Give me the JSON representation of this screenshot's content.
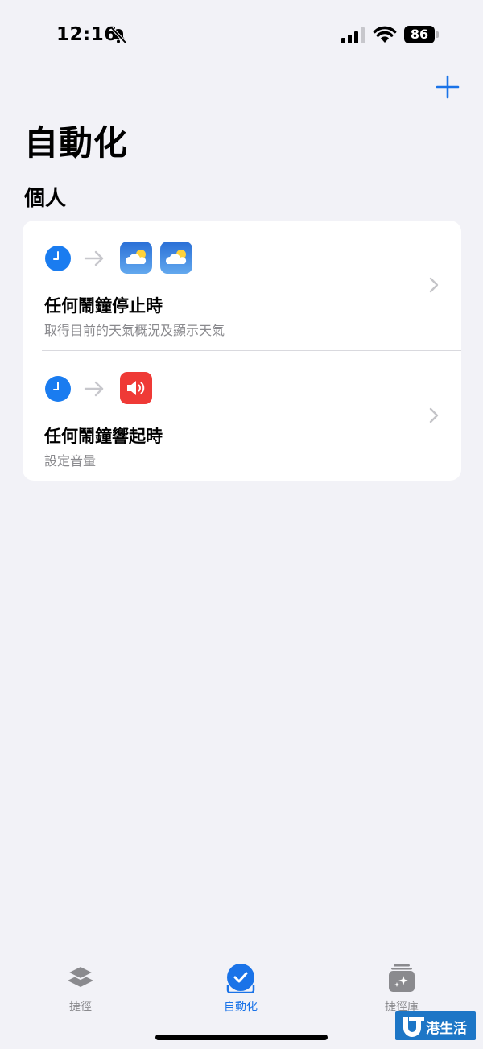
{
  "status_bar": {
    "time": "12:16",
    "battery": "86"
  },
  "header": {
    "title": "自動化",
    "add_icon": "plus-icon"
  },
  "section": {
    "title": "個人"
  },
  "automations": [
    {
      "title": "任何鬧鐘停止時",
      "subtitle": "取得目前的天氣概況及顯示天氣",
      "trigger_icon": "clock-icon",
      "action_icons": [
        "weather-app-icon",
        "weather-app-icon"
      ]
    },
    {
      "title": "任何鬧鐘響起時",
      "subtitle": "設定音量",
      "trigger_icon": "clock-icon",
      "action_icons": [
        "volume-app-icon"
      ]
    }
  ],
  "tabs": [
    {
      "label": "捷徑",
      "icon": "layers-icon",
      "active": false
    },
    {
      "label": "自動化",
      "icon": "checkmark-circle-icon",
      "active": true
    },
    {
      "label": "捷徑庫",
      "icon": "gallery-sparkle-icon",
      "active": false
    }
  ],
  "watermark": {
    "text": "港生活"
  },
  "colors": {
    "accent": "#1a73e8",
    "background": "#f2f2f7",
    "card": "#ffffff",
    "secondary_text": "#8a8a8e",
    "volume_red": "#ef3a36"
  }
}
